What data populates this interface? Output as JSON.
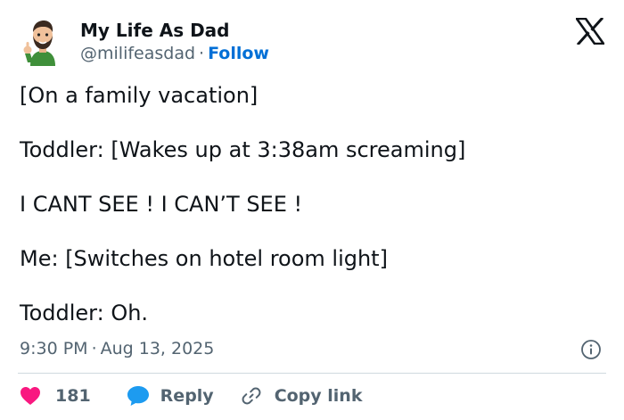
{
  "author": {
    "name": "My Life As Dad",
    "handle": "@milifeasdad",
    "separator": "·",
    "follow_label": "Follow"
  },
  "icons": {
    "brand": "x-logo-icon",
    "info": "info-icon",
    "like": "heart-icon",
    "reply": "speech-bubble-icon",
    "copy_link": "link-icon"
  },
  "tweet": {
    "lines": [
      "[On a family vacation]",
      "Toddler: [Wakes up at 3:38am screaming]",
      "I CANT SEE ! I CAN’T SEE !",
      "Me: [Switches on hotel room light]",
      "Toddler: Oh."
    ]
  },
  "meta": {
    "time": "9:30 PM",
    "separator": "·",
    "date": "Aug 13, 2025"
  },
  "actions": {
    "like_count": "181",
    "reply_label": "Reply",
    "copy_link_label": "Copy link"
  },
  "colors": {
    "text": "#0f1419",
    "secondary": "#536471",
    "link": "#006fd6",
    "like": "#f91880",
    "reply": "#1d9bf0",
    "divider": "#cfd9de"
  }
}
